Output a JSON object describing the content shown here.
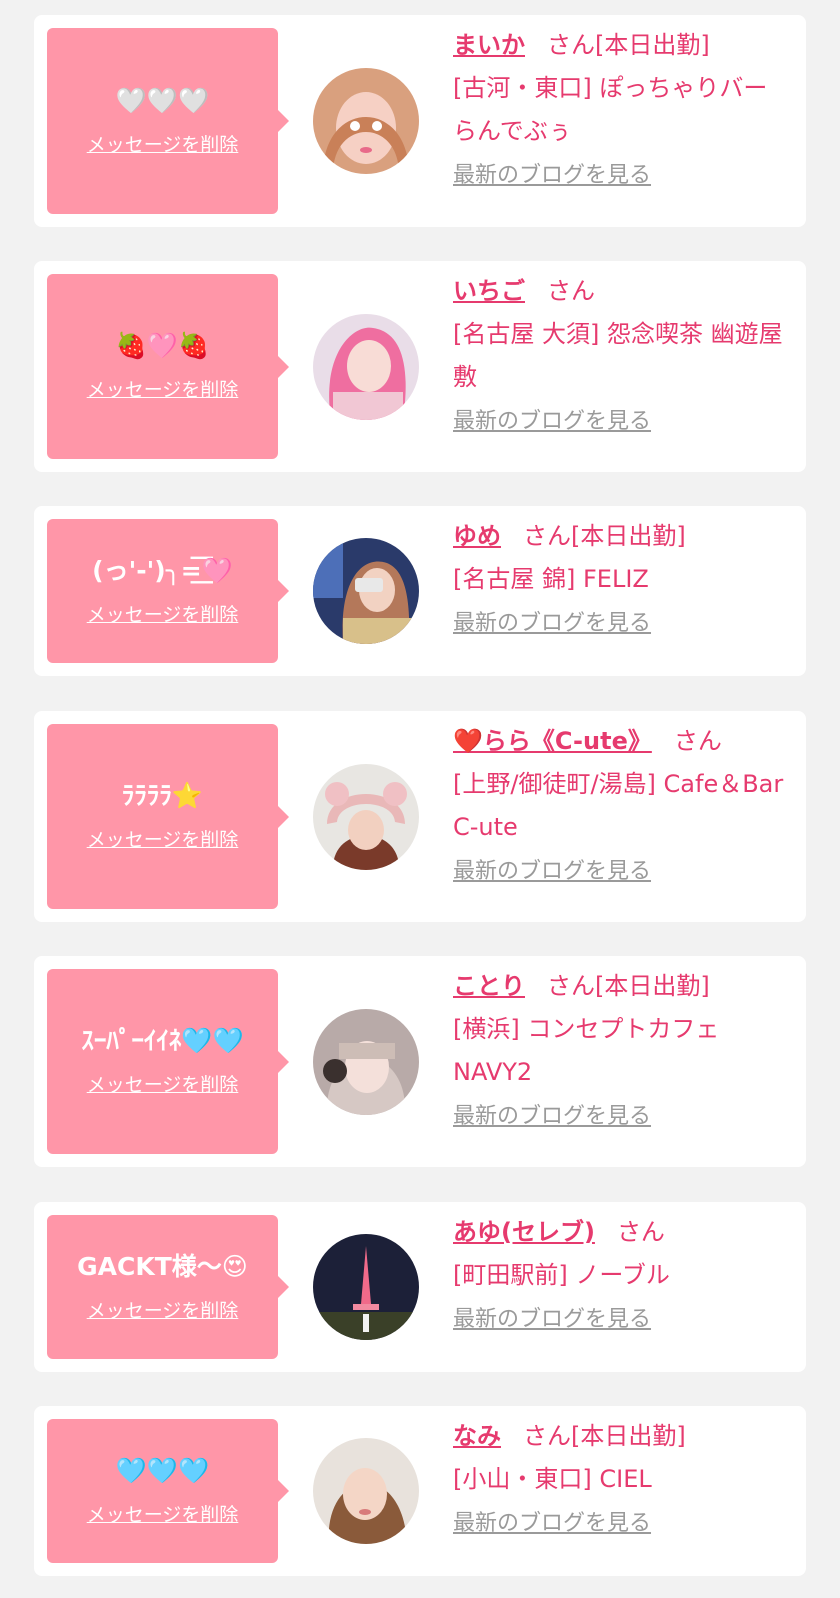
{
  "delete_label": "メッセージを削除",
  "blog_label": "最新のブログを見る",
  "colors": {
    "bubble": "#ff96a8",
    "accent": "#e63a6e",
    "link_gray": "#9a9a9a",
    "background": "#f2f2f2"
  },
  "cards": [
    {
      "message": "🤍🤍🤍",
      "name": "まいか",
      "suffix": "さん[本日出勤]",
      "shop": "[古河・東口] ぽっちゃりバー らんでぶぅ",
      "avatar": "avatar-photo-1"
    },
    {
      "message": "🍓🩷🍓",
      "name": "いちご",
      "suffix": "さん",
      "shop": "[名古屋 大須] 怨念喫茶 幽遊屋敷",
      "avatar": "avatar-photo-2"
    },
    {
      "message": "(っ'-')╮=͟͟͞͞🩷",
      "name": "ゆめ",
      "suffix": "さん[本日出勤]",
      "shop": "[名古屋 錦] FELIZ",
      "avatar": "avatar-photo-3"
    },
    {
      "message": "ﾗﾗﾗﾗ⭐",
      "name": "❤️らら《C-ute》",
      "suffix": "さん",
      "shop": "[上野/御徒町/湯島] Cafe＆Bar C-ute",
      "avatar": "avatar-photo-4"
    },
    {
      "message": "ｽｰﾊﾟｰｲｲﾈ🩵🩵",
      "name": "ことり",
      "suffix": "さん[本日出勤]",
      "shop": "[横浜] コンセプトカフェ NAVY2",
      "avatar": "avatar-photo-5"
    },
    {
      "message": "GACKT様〜😍",
      "name": "あゆ(セレブ)",
      "suffix": "さん",
      "shop": "[町田駅前] ノーブル",
      "avatar": "avatar-photo-6"
    },
    {
      "message": "🩵🩵🩵",
      "name": "なみ",
      "suffix": "さん[本日出勤]",
      "shop": "[小山・東口] CIEL",
      "avatar": "avatar-photo-7"
    }
  ]
}
